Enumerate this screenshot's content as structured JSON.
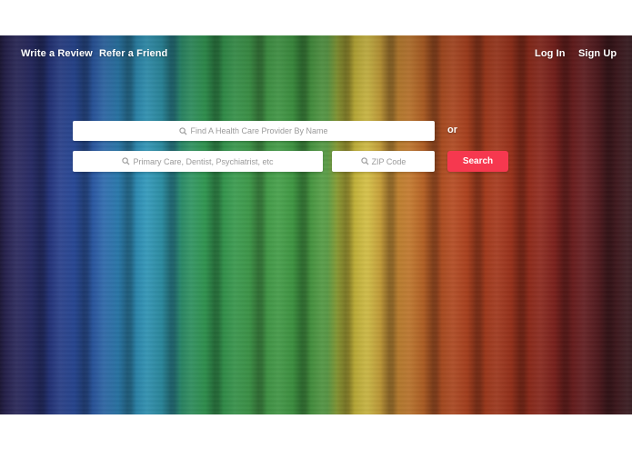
{
  "nav": {
    "write_review": "Write a Review",
    "refer_friend": "Refer a Friend",
    "log_in": "Log In",
    "sign_up": "Sign Up"
  },
  "search": {
    "provider_placeholder": "Find A Health Care Provider By Name",
    "specialty_placeholder": "Primary Care, Dentist, Psychiatrist, etc",
    "zip_placeholder": "ZIP Code",
    "or_label": "or",
    "search_label": "Search",
    "button_color": "#f6384f"
  },
  "icons": [
    "search-icon"
  ]
}
